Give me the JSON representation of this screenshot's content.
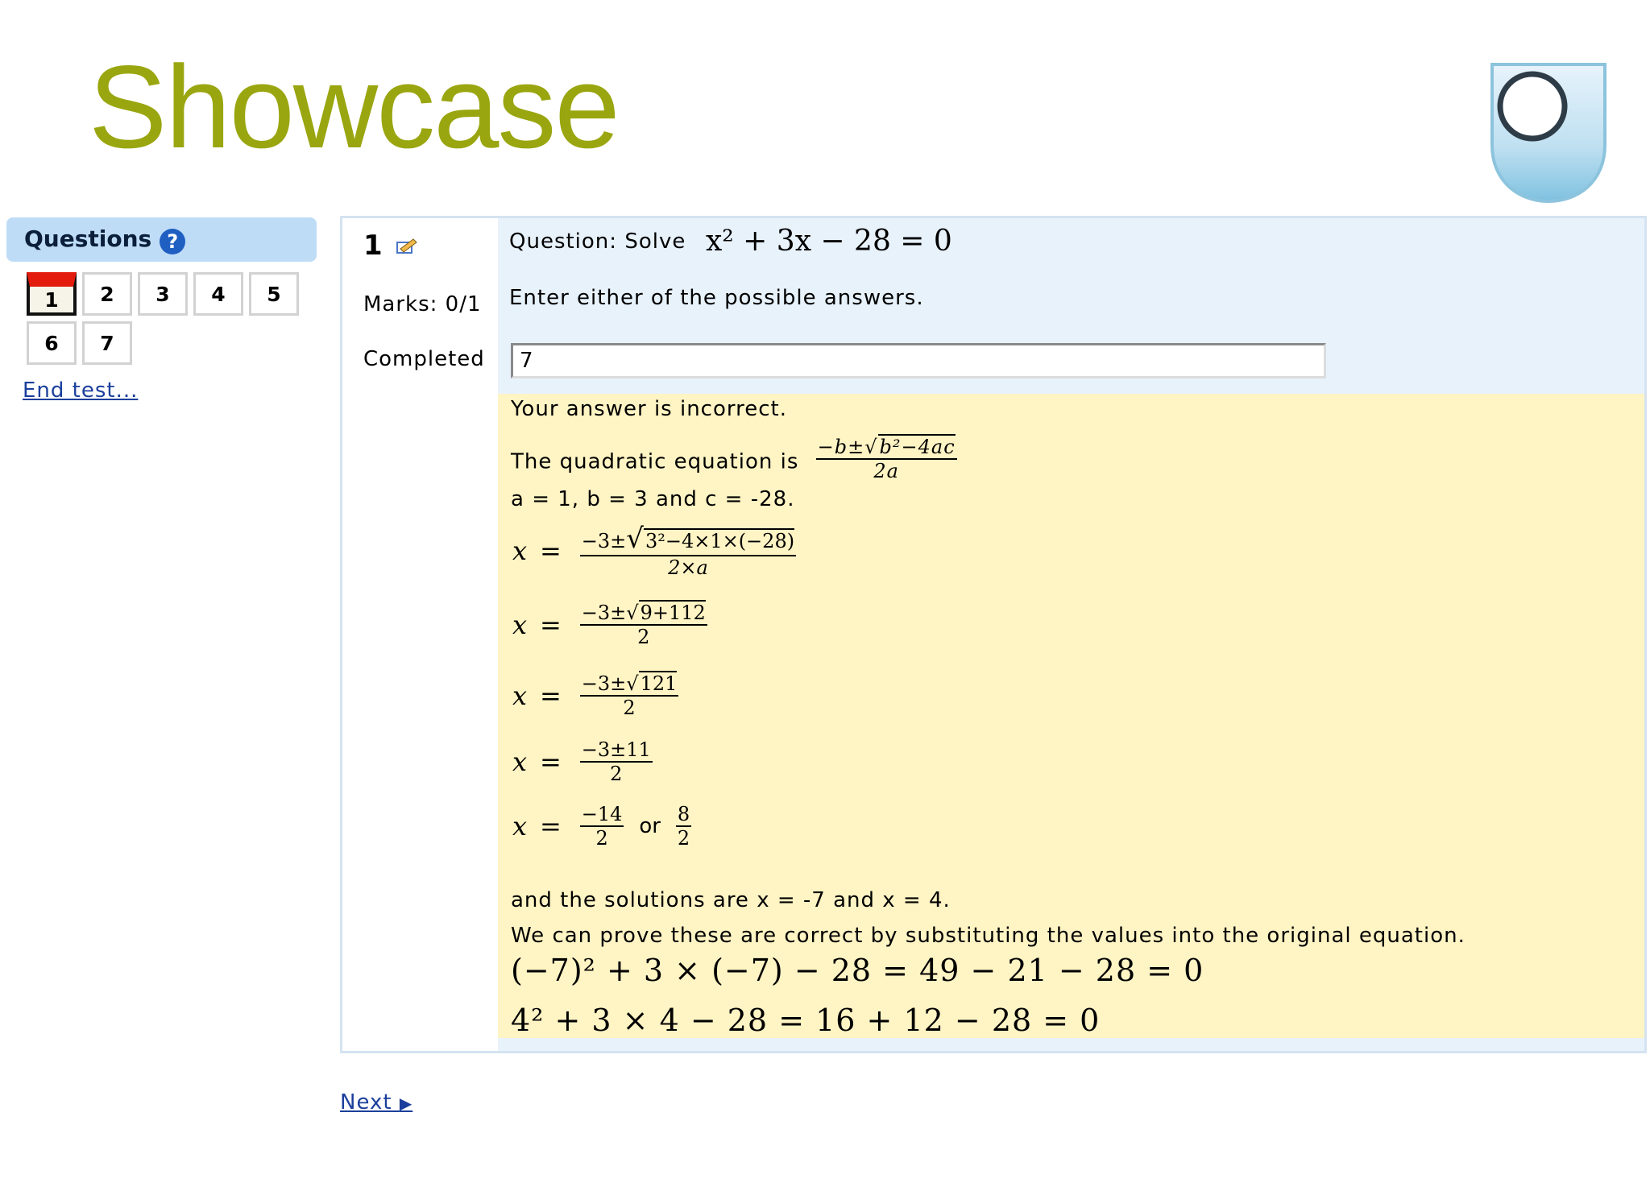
{
  "slide": {
    "title": "Showcase"
  },
  "sidebar": {
    "heading": "Questions",
    "help_glyph": "?",
    "questions": [
      "1",
      "2",
      "3",
      "4",
      "5",
      "6",
      "7"
    ],
    "current_question": "1",
    "end_link": "End test..."
  },
  "question": {
    "number": "1",
    "marks": "Marks: 0/1",
    "status": "Completed",
    "prompt_label": "Question: Solve",
    "prompt_math": "x² + 3x − 28 = 0",
    "instruction": "Enter either of the possible answers.",
    "answer_value": "7"
  },
  "feedback": {
    "verdict": "Your answer is incorrect.",
    "formula_label": "The quadratic equation is",
    "formula_num": "−b±√b²−4ac",
    "formula_num_a": "−b±",
    "formula_num_rad": "b²−4ac",
    "formula_den": "2a",
    "coefficients": "a = 1, b = 3 and c = -28.",
    "steps": [
      {
        "lhs": "x",
        "num_a": "−3±",
        "num_rad": "3²−4×1×(−28)",
        "den": "2×a"
      },
      {
        "lhs": "x",
        "num_a": "−3±",
        "num_rad": "9+112",
        "den": "2"
      },
      {
        "lhs": "x",
        "num_a": "−3±",
        "num_rad": "121",
        "den": "2"
      },
      {
        "lhs": "x",
        "num_a": "−3±11",
        "num_rad": "",
        "den": "2"
      }
    ],
    "final_step": {
      "lhs": "x",
      "f1_num": "−14",
      "f1_den": "2",
      "or": "or",
      "f2_num": "8",
      "f2_den": "2"
    },
    "solutions": "and the solutions are x = -7 and x = 4.",
    "proof_intro": "We can prove these are correct by substituting the values into the original equation.",
    "proof_1": "(−7)² + 3 × (−7) − 28 = 49 − 21 − 28 = 0",
    "proof_2": "4² + 3 × 4 − 28 = 16 + 12 − 28 = 0"
  },
  "nav": {
    "next_label": "Next"
  },
  "colors": {
    "title": "#9aa60f",
    "question_bg": "#e8f2fb",
    "feedback_bg": "#fff4c4",
    "current_flag": "#e31b0c",
    "link": "#1b3f9c"
  }
}
